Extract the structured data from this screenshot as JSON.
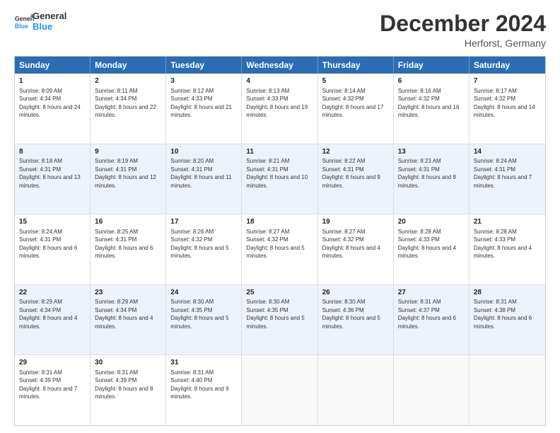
{
  "header": {
    "logo_line1": "General",
    "logo_line2": "Blue",
    "title": "December 2024",
    "location": "Herforst, Germany"
  },
  "calendar": {
    "weekdays": [
      "Sunday",
      "Monday",
      "Tuesday",
      "Wednesday",
      "Thursday",
      "Friday",
      "Saturday"
    ],
    "rows": [
      [
        {
          "day": "1",
          "sunrise": "8:09 AM",
          "sunset": "4:34 PM",
          "daylight": "8 hours and 24 minutes."
        },
        {
          "day": "2",
          "sunrise": "8:11 AM",
          "sunset": "4:34 PM",
          "daylight": "8 hours and 22 minutes."
        },
        {
          "day": "3",
          "sunrise": "8:12 AM",
          "sunset": "4:33 PM",
          "daylight": "8 hours and 21 minutes."
        },
        {
          "day": "4",
          "sunrise": "8:13 AM",
          "sunset": "4:33 PM",
          "daylight": "8 hours and 19 minutes."
        },
        {
          "day": "5",
          "sunrise": "8:14 AM",
          "sunset": "4:32 PM",
          "daylight": "8 hours and 17 minutes."
        },
        {
          "day": "6",
          "sunrise": "8:16 AM",
          "sunset": "4:32 PM",
          "daylight": "8 hours and 16 minutes."
        },
        {
          "day": "7",
          "sunrise": "8:17 AM",
          "sunset": "4:32 PM",
          "daylight": "8 hours and 14 minutes."
        }
      ],
      [
        {
          "day": "8",
          "sunrise": "8:18 AM",
          "sunset": "4:31 PM",
          "daylight": "8 hours and 13 minutes."
        },
        {
          "day": "9",
          "sunrise": "8:19 AM",
          "sunset": "4:31 PM",
          "daylight": "8 hours and 12 minutes."
        },
        {
          "day": "10",
          "sunrise": "8:20 AM",
          "sunset": "4:31 PM",
          "daylight": "8 hours and 11 minutes."
        },
        {
          "day": "11",
          "sunrise": "8:21 AM",
          "sunset": "4:31 PM",
          "daylight": "8 hours and 10 minutes."
        },
        {
          "day": "12",
          "sunrise": "8:22 AM",
          "sunset": "4:31 PM",
          "daylight": "8 hours and 9 minutes."
        },
        {
          "day": "13",
          "sunrise": "8:23 AM",
          "sunset": "4:31 PM",
          "daylight": "8 hours and 8 minutes."
        },
        {
          "day": "14",
          "sunrise": "8:24 AM",
          "sunset": "4:31 PM",
          "daylight": "8 hours and 7 minutes."
        }
      ],
      [
        {
          "day": "15",
          "sunrise": "8:24 AM",
          "sunset": "4:31 PM",
          "daylight": "8 hours and 6 minutes."
        },
        {
          "day": "16",
          "sunrise": "8:25 AM",
          "sunset": "4:31 PM",
          "daylight": "8 hours and 6 minutes."
        },
        {
          "day": "17",
          "sunrise": "8:26 AM",
          "sunset": "4:32 PM",
          "daylight": "8 hours and 5 minutes."
        },
        {
          "day": "18",
          "sunrise": "8:27 AM",
          "sunset": "4:32 PM",
          "daylight": "8 hours and 5 minutes."
        },
        {
          "day": "19",
          "sunrise": "8:27 AM",
          "sunset": "4:32 PM",
          "daylight": "8 hours and 4 minutes."
        },
        {
          "day": "20",
          "sunrise": "8:28 AM",
          "sunset": "4:33 PM",
          "daylight": "8 hours and 4 minutes."
        },
        {
          "day": "21",
          "sunrise": "8:28 AM",
          "sunset": "4:33 PM",
          "daylight": "8 hours and 4 minutes."
        }
      ],
      [
        {
          "day": "22",
          "sunrise": "8:29 AM",
          "sunset": "4:34 PM",
          "daylight": "8 hours and 4 minutes."
        },
        {
          "day": "23",
          "sunrise": "8:29 AM",
          "sunset": "4:34 PM",
          "daylight": "8 hours and 4 minutes."
        },
        {
          "day": "24",
          "sunrise": "8:30 AM",
          "sunset": "4:35 PM",
          "daylight": "8 hours and 5 minutes."
        },
        {
          "day": "25",
          "sunrise": "8:30 AM",
          "sunset": "4:35 PM",
          "daylight": "8 hours and 5 minutes."
        },
        {
          "day": "26",
          "sunrise": "8:30 AM",
          "sunset": "4:36 PM",
          "daylight": "8 hours and 5 minutes."
        },
        {
          "day": "27",
          "sunrise": "8:31 AM",
          "sunset": "4:37 PM",
          "daylight": "8 hours and 6 minutes."
        },
        {
          "day": "28",
          "sunrise": "8:31 AM",
          "sunset": "4:38 PM",
          "daylight": "8 hours and 6 minutes."
        }
      ],
      [
        {
          "day": "29",
          "sunrise": "8:31 AM",
          "sunset": "4:39 PM",
          "daylight": "8 hours and 7 minutes."
        },
        {
          "day": "30",
          "sunrise": "8:31 AM",
          "sunset": "4:39 PM",
          "daylight": "8 hours and 8 minutes."
        },
        {
          "day": "31",
          "sunrise": "8:31 AM",
          "sunset": "4:40 PM",
          "daylight": "8 hours and 9 minutes."
        },
        null,
        null,
        null,
        null
      ]
    ]
  }
}
